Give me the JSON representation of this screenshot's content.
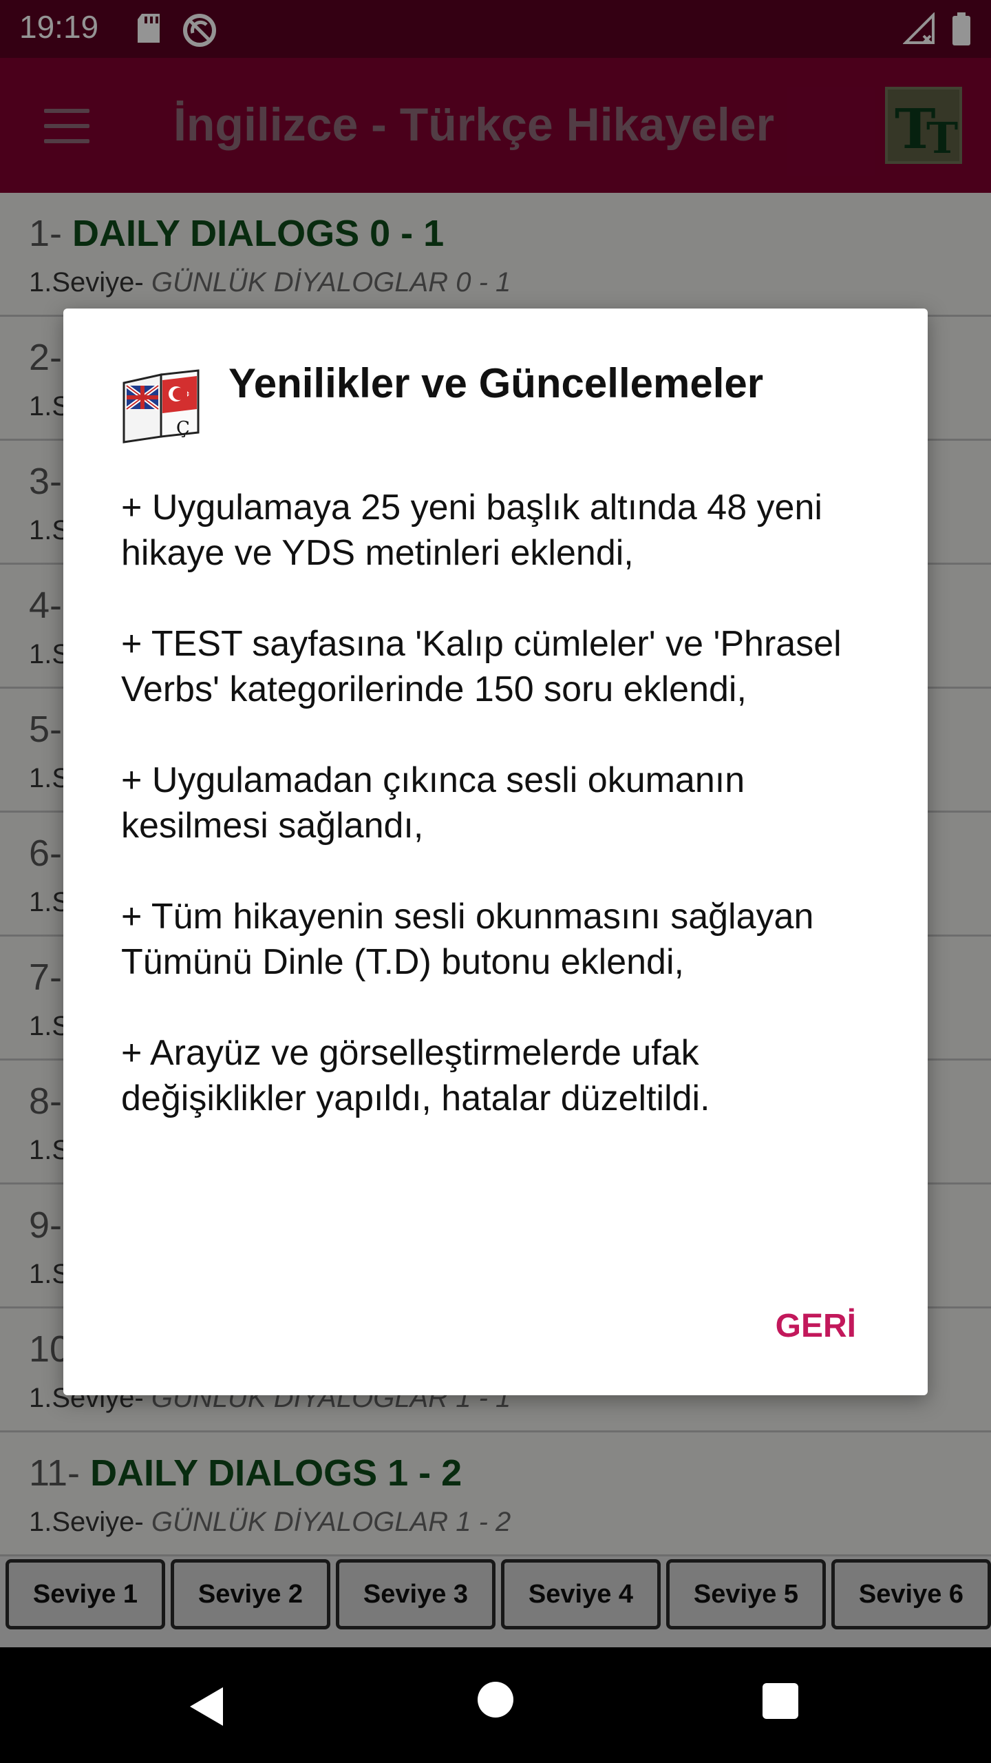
{
  "status_bar": {
    "time": "19:19"
  },
  "app_bar": {
    "title": "İngilizce - Türkçe Hikayeler",
    "logo_text_big": "T",
    "logo_text_small": "T"
  },
  "list": [
    {
      "num": "1-",
      "title": "DAILY DIALOGS 0 - 1",
      "level": "1.Seviye-",
      "subtitle": "GÜNLÜK DİYALOGLAR 0 - 1"
    },
    {
      "num": "2-",
      "title": "",
      "level": "1.S",
      "subtitle": ""
    },
    {
      "num": "3-",
      "title": "",
      "level": "1.S",
      "subtitle": ""
    },
    {
      "num": "4-",
      "title": "",
      "level": "1.S",
      "subtitle": ""
    },
    {
      "num": "5-",
      "title": "",
      "level": "1.S",
      "subtitle": ""
    },
    {
      "num": "6-",
      "title": "",
      "level": "1.S",
      "subtitle": ""
    },
    {
      "num": "7-",
      "title": "",
      "level": "1.S",
      "subtitle": ""
    },
    {
      "num": "8-",
      "title": "",
      "level": "1.S",
      "subtitle": ""
    },
    {
      "num": "9-",
      "title": "",
      "level": "1.S",
      "subtitle": ""
    },
    {
      "num": "10",
      "title": "",
      "level": "1.Seviye-",
      "subtitle": "GÜNLÜK DİYALOGLAR 1 - 1"
    },
    {
      "num": "11-",
      "title": "DAILY DIALOGS 1 - 2",
      "level": "1.Seviye-",
      "subtitle": "GÜNLÜK DİYALOGLAR 1 - 2"
    }
  ],
  "levels": [
    "Seviye 1",
    "Seviye 2",
    "Seviye 3",
    "Seviye 4",
    "Seviye 5",
    "Seviye 6"
  ],
  "dialog": {
    "title": "Yenilikler ve Güncellemeler",
    "paragraphs": [
      "+ Uygulamaya 25 yeni başlık altında 48 yeni hikaye ve YDS metinleri eklendi,",
      "+ TEST sayfasına 'Kalıp cümleler' ve 'Phrasel Verbs' kategorilerinde 150 soru eklendi,",
      "+ Uygulamadan çıkınca sesli okumanın kesilmesi sağlandı,",
      "+ Tüm hikayenin sesli okunmasını sağlayan Tümünü Dinle (T.D) butonu eklendi,",
      "+ Arayüz ve görselleştirmelerde ufak değişiklikler yapıldı, hatalar düzeltildi."
    ],
    "button_label": "GERİ",
    "accent_color": "#c2185b"
  },
  "colors": {
    "app_bar": "#800030",
    "status_bar": "#5a0021",
    "title_green": "#0f4a1a"
  }
}
